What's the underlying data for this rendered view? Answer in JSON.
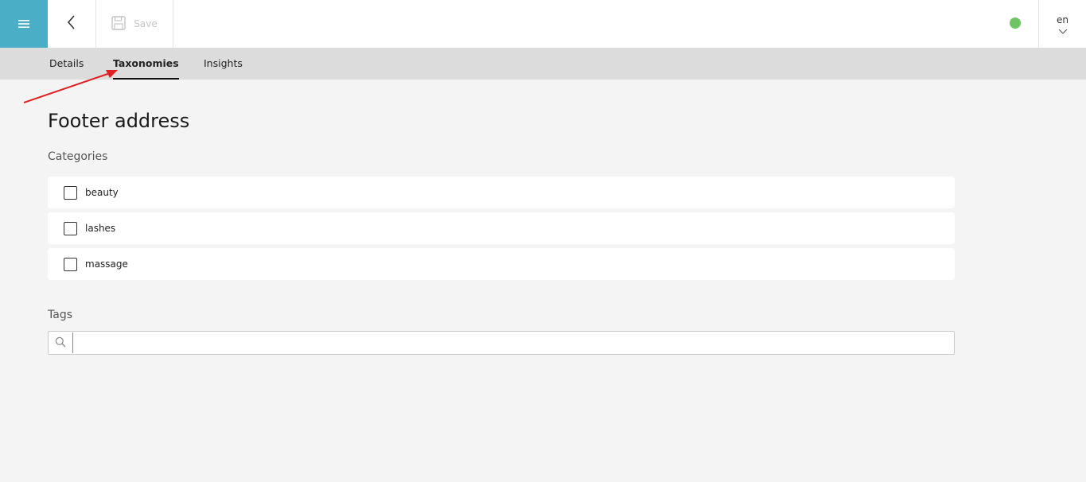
{
  "topbar": {
    "menu_icon": "hamburger-icon",
    "back_icon": "chevron-left-icon",
    "save_icon": "floppy-disk-icon",
    "save_label": "Save",
    "status_color": "#6cc462",
    "language": "en",
    "language_icon": "chevron-down-icon",
    "accent_color": "#4aafc6"
  },
  "tabs": [
    {
      "label": "Details",
      "active": false
    },
    {
      "label": "Taxonomies",
      "active": true
    },
    {
      "label": "Insights",
      "active": false
    }
  ],
  "main": {
    "title": "Footer address",
    "categories_label": "Categories",
    "categories": [
      {
        "label": "beauty",
        "checked": false
      },
      {
        "label": "lashes",
        "checked": false
      },
      {
        "label": "massage",
        "checked": false
      }
    ],
    "tags_label": "Tags",
    "tags_input_value": "",
    "tags_input_placeholder": "",
    "search_icon": "search-icon"
  }
}
